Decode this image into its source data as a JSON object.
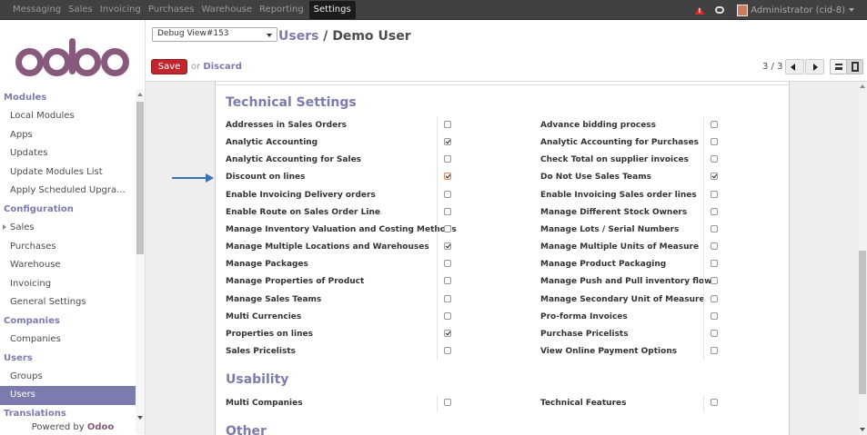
{
  "topbar": {
    "menu": [
      "Messaging",
      "Sales",
      "Invoicing",
      "Purchases",
      "Warehouse",
      "Reporting",
      "Settings"
    ],
    "active": "Settings",
    "user": "Administrator (cid-8)"
  },
  "sidebar": {
    "sections": [
      {
        "title": "Modules",
        "items": [
          "Local Modules",
          "Apps",
          "Updates",
          "Update Modules List",
          "Apply Scheduled Upgra..."
        ]
      },
      {
        "title": "Configuration",
        "items": [
          "Sales",
          "Purchases",
          "Warehouse",
          "Invoicing",
          "General Settings"
        ]
      },
      {
        "title": "Companies",
        "items": [
          "Companies"
        ]
      },
      {
        "title": "Users",
        "items": [
          "Groups",
          "Users"
        ]
      },
      {
        "title": "Translations",
        "items": []
      }
    ],
    "selected": "Users",
    "expandable": "Sales",
    "powered_by": "Powered by",
    "powered_brand": "Odoo"
  },
  "header": {
    "debug_select": "Debug View#153",
    "breadcrumb_parent": "Users",
    "breadcrumb_sep": " / ",
    "breadcrumb_current": "Demo User",
    "save_label": "Save",
    "or_text": "or",
    "discard_label": "Discard",
    "pager": "3 / 3"
  },
  "form": {
    "technical_title": "Technical Settings",
    "technical_rows": [
      {
        "left": "Addresses in Sales Orders",
        "left_checked": false,
        "right": "Advance bidding process",
        "right_checked": false
      },
      {
        "left": "Analytic Accounting",
        "left_checked": true,
        "right": "Analytic Accounting for Purchases",
        "right_checked": false
      },
      {
        "left": "Analytic Accounting for Sales",
        "left_checked": false,
        "right": "Check Total on supplier invoices",
        "right_checked": false
      },
      {
        "left": "Discount on lines",
        "left_checked": true,
        "right": "Do Not Use Sales Teams",
        "right_checked": true
      },
      {
        "left": "Enable Invoicing Delivery orders",
        "left_checked": false,
        "right": "Enable Invoicing Sales order lines",
        "right_checked": false
      },
      {
        "left": "Enable Route on Sales Order Line",
        "left_checked": false,
        "right": "Manage Different Stock Owners",
        "right_checked": false
      },
      {
        "left": "Manage Inventory Valuation and Costing Methods",
        "left_checked": false,
        "right": "Manage Lots / Serial Numbers",
        "right_checked": false
      },
      {
        "left": "Manage Multiple Locations and Warehouses",
        "left_checked": true,
        "right": "Manage Multiple Units of Measure",
        "right_checked": false
      },
      {
        "left": "Manage Packages",
        "left_checked": false,
        "right": "Manage Product Packaging",
        "right_checked": false
      },
      {
        "left": "Manage Properties of Product",
        "left_checked": false,
        "right": "Manage Push and Pull inventory flows",
        "right_checked": false
      },
      {
        "left": "Manage Sales Teams",
        "left_checked": false,
        "right": "Manage Secondary Unit of Measure",
        "right_checked": false
      },
      {
        "left": "Multi Currencies",
        "left_checked": false,
        "right": "Pro-forma Invoices",
        "right_checked": false
      },
      {
        "left": "Properties on lines",
        "left_checked": true,
        "right": "Purchase Pricelists",
        "right_checked": false
      },
      {
        "left": "Sales Pricelists",
        "left_checked": false,
        "right": "View Online Payment Options",
        "right_checked": false
      }
    ],
    "usability_title": "Usability",
    "usability_rows": [
      {
        "left": "Multi Companies",
        "left_checked": false,
        "right": "Technical Features",
        "right_checked": false
      }
    ],
    "other_title": "Other",
    "highlighted": "Discount on lines"
  },
  "colors": {
    "accent": "#7c7bad",
    "brand": "#875a7b",
    "save": "#c0262b",
    "topbar": "#414141",
    "arrow": "#3d6fb3"
  }
}
